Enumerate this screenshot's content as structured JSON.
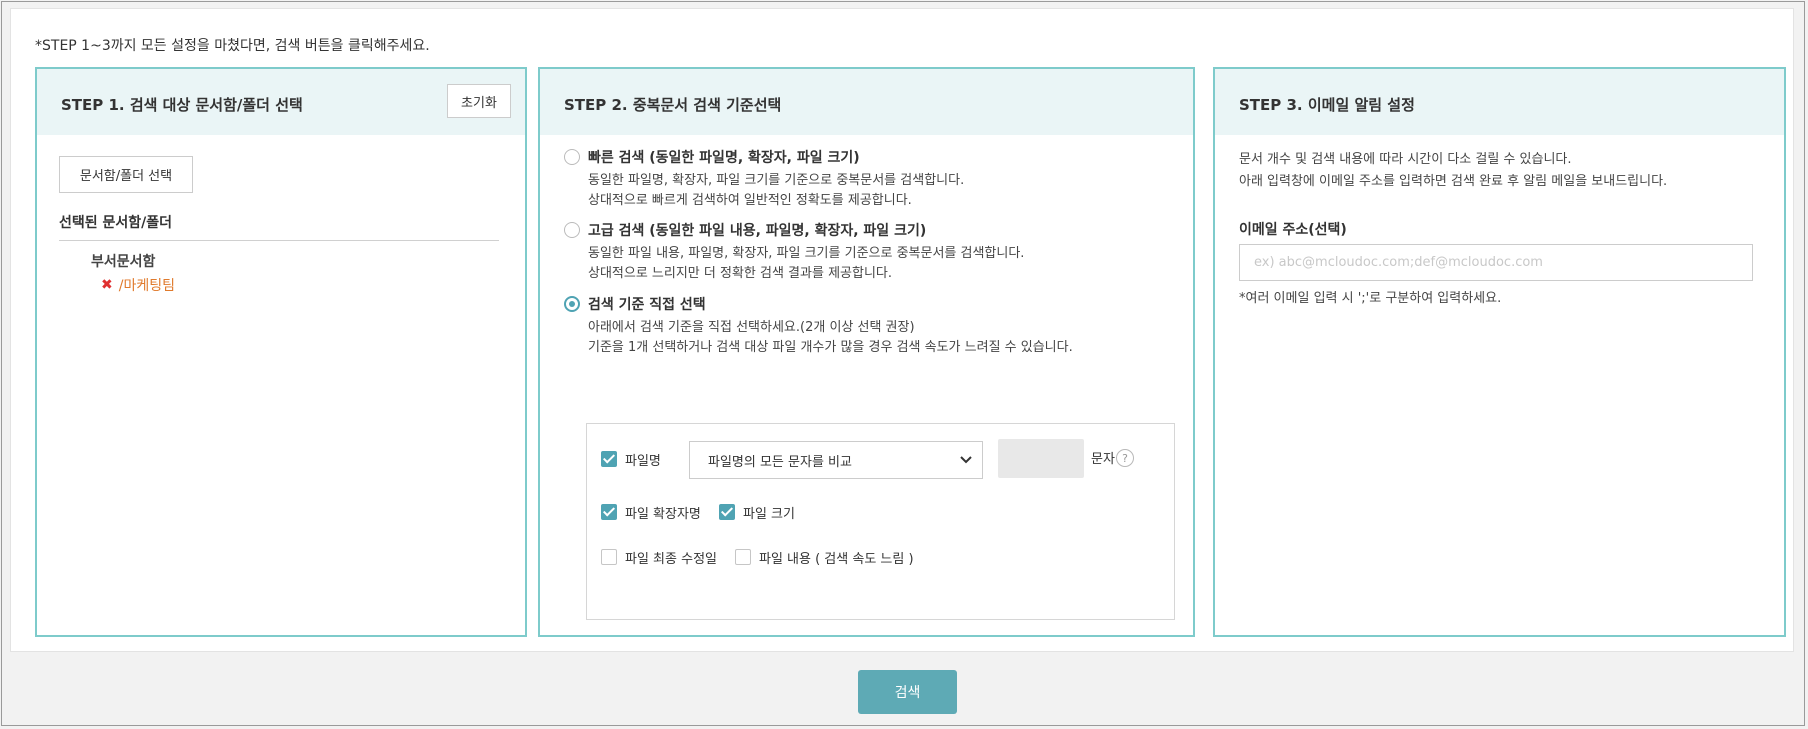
{
  "notice": "*STEP 1~3까지 모든 설정을 마쳤다면, 검색 버튼을 클릭해주세요.",
  "step1": {
    "title": "STEP 1. 검색 대상 문서함/폴더 선택",
    "reset_label": "초기화",
    "select_button": "문서함/폴더 선택",
    "selected_label": "선택된 문서함/폴더",
    "tree_root": "부서문서함",
    "tree_child": "/마케팅팀"
  },
  "step2": {
    "title": "STEP 2. 중복문서 검색 기준선택",
    "options": [
      {
        "title": "빠른 검색 (동일한 파일명, 확장자, 파일 크기)",
        "desc1": "동일한 파일명, 확장자, 파일 크기를 기준으로 중복문서를 검색합니다.",
        "desc2": "상대적으로 빠르게 검색하여 일반적인 정확도를 제공합니다.",
        "selected": false
      },
      {
        "title": "고급 검색 (동일한 파일 내용, 파일명, 확장자, 파일 크기)",
        "desc1": "동일한 파일 내용, 파일명, 확장자, 파일 크기를 기준으로 중복문서를 검색합니다.",
        "desc2": "상대적으로 느리지만 더 정확한 검색 결과를 제공합니다.",
        "selected": false
      },
      {
        "title": "검색 기준 직접 선택",
        "desc1": "아래에서 검색 기준을 직접 선택하세요.(2개 이상 선택 권장)",
        "desc2": "기준을 1개 선택하거나 검색 대상 파일 개수가 많을 경우 검색 속도가 느려질 수 있습니다.",
        "selected": true
      }
    ],
    "criteria": {
      "filename_label": "파일명",
      "filename_checked": true,
      "filename_mode": "파일명의 모든 문자를 비교",
      "char_value": "",
      "char_unit": "문자",
      "help_glyph": "?",
      "extension_label": "파일 확장자명",
      "extension_checked": true,
      "size_label": "파일 크기",
      "size_checked": true,
      "modified_label": "파일 최종 수정일",
      "modified_checked": false,
      "content_label": "파일 내용 ( 검색 속도 느림 )",
      "content_checked": false
    }
  },
  "step3": {
    "title": "STEP 3. 이메일 알림 설정",
    "desc1": "문서 개수 및 검색 내용에 따라 시간이 다소 걸릴 수 있습니다.",
    "desc2": "아래 입력창에 이메일 주소를 입력하면 검색 완료 후 알림 메일을 보내드립니다.",
    "email_label": "이메일 주소(선택)",
    "email_value": "",
    "email_placeholder": "ex) abc@mcloudoc.com;def@mcloudoc.com",
    "email_help": "*여러 이메일 입력 시 ';'로 구분하여 입력하세요."
  },
  "search_button": "검색",
  "colors": {
    "accent": "#5eaab5",
    "panel_border": "#7ecbcb",
    "panel_header": "#eaf5f6",
    "tree_child": "#e07a2c",
    "remove_icon": "#e03030"
  }
}
